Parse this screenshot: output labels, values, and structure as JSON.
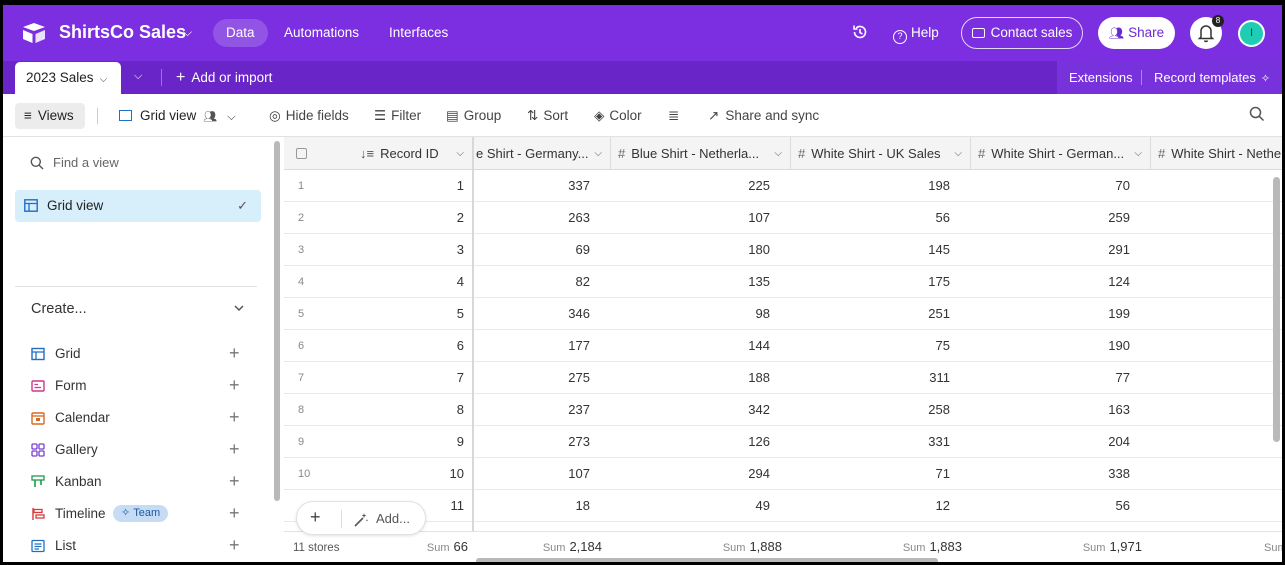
{
  "topbar": {
    "base_name": "ShirtsCo Sales",
    "nav": [
      "Data",
      "Automations",
      "Interfaces"
    ],
    "help": "Help",
    "contact_sales": "Contact sales",
    "share": "Share",
    "notification_count": "8",
    "avatar_initial": "I"
  },
  "tablebar": {
    "active_table": "2023 Sales",
    "add_import": "Add or import",
    "extensions": "Extensions",
    "record_templates": "Record templates"
  },
  "toolbar": {
    "views": "Views",
    "grid_view": "Grid view",
    "hide_fields": "Hide fields",
    "filter": "Filter",
    "group": "Group",
    "sort": "Sort",
    "color": "Color",
    "share_sync": "Share and sync"
  },
  "sidebar": {
    "find_placeholder": "Find a view",
    "active_view": "Grid view",
    "create_label": "Create...",
    "create_items": [
      {
        "label": "Grid"
      },
      {
        "label": "Form"
      },
      {
        "label": "Calendar"
      },
      {
        "label": "Gallery"
      },
      {
        "label": "Kanban"
      },
      {
        "label": "Timeline",
        "badge": "Team"
      },
      {
        "label": "List"
      }
    ]
  },
  "grid": {
    "columns": [
      "Record ID",
      "e Shirt - Germany...",
      "Blue Shirt - Netherla...",
      "White Shirt - UK Sales",
      "White Shirt - German...",
      "White Shirt - Nethe"
    ],
    "rows": [
      {
        "num": "1",
        "id": "1",
        "v": [
          "337",
          "225",
          "198",
          "70"
        ]
      },
      {
        "num": "2",
        "id": "2",
        "v": [
          "263",
          "107",
          "56",
          "259"
        ]
      },
      {
        "num": "3",
        "id": "3",
        "v": [
          "69",
          "180",
          "145",
          "291"
        ]
      },
      {
        "num": "4",
        "id": "4",
        "v": [
          "82",
          "135",
          "175",
          "124"
        ]
      },
      {
        "num": "5",
        "id": "5",
        "v": [
          "346",
          "98",
          "251",
          "199"
        ]
      },
      {
        "num": "6",
        "id": "6",
        "v": [
          "177",
          "144",
          "75",
          "190"
        ]
      },
      {
        "num": "7",
        "id": "7",
        "v": [
          "275",
          "188",
          "311",
          "77"
        ]
      },
      {
        "num": "8",
        "id": "8",
        "v": [
          "237",
          "342",
          "258",
          "163"
        ]
      },
      {
        "num": "9",
        "id": "9",
        "v": [
          "273",
          "126",
          "331",
          "204"
        ]
      },
      {
        "num": "10",
        "id": "10",
        "v": [
          "107",
          "294",
          "71",
          "338"
        ]
      },
      {
        "num": "",
        "id": "11",
        "v": [
          "18",
          "49",
          "12",
          "56"
        ]
      }
    ],
    "footer": {
      "count": "11 stores",
      "sum_label": "Sum",
      "sums": [
        "66",
        "2,184",
        "1,888",
        "1,883",
        "1,971"
      ]
    },
    "add_label": "Add..."
  }
}
